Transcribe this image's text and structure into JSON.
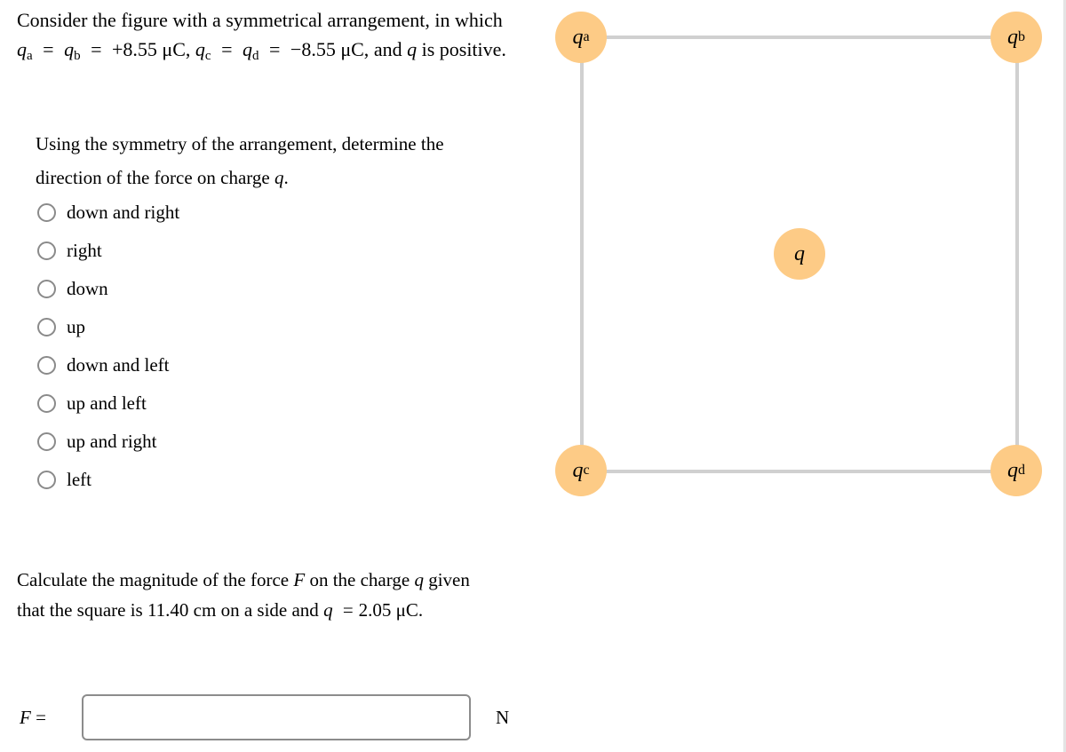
{
  "intro": {
    "line1": "Consider the figure with a symmetrical arrangement, in which",
    "qa_sym": "q",
    "qa_sub": "a",
    "qb_sym": "q",
    "qb_sub": "b",
    "positive_value": "+8.55 μC,",
    "qc_sym": "q",
    "qc_sub": "c",
    "qd_sym": "q",
    "qd_sub": "d",
    "negative_value": "−8.55 μC,",
    "tail_and": "and",
    "q_sym": "q",
    "tail": "is positive.",
    "equals": "="
  },
  "question": {
    "line1": "Using the symmetry of the arrangement, determine the",
    "line2_prefix": "direction of the force on charge",
    "q_sym": "q",
    "line2_suffix": "."
  },
  "options": [
    {
      "label": "down and right",
      "selected": false
    },
    {
      "label": "right",
      "selected": false
    },
    {
      "label": "down",
      "selected": false
    },
    {
      "label": "up",
      "selected": false
    },
    {
      "label": "down and left",
      "selected": false
    },
    {
      "label": "up and left",
      "selected": false
    },
    {
      "label": "up and right",
      "selected": false
    },
    {
      "label": "left",
      "selected": false
    }
  ],
  "calc": {
    "line1_prefix": "Calculate the magnitude of the force",
    "F_sym": "F",
    "line1_mid": "on the charge",
    "q_sym": "q",
    "line1_suffix": "given",
    "line2_prefix": "that the square is 11.40 cm on a side and",
    "q_sym2": "q",
    "equals": "=",
    "line2_value": "2.05 μC."
  },
  "answer": {
    "label_sym": "F",
    "label_eq": "=",
    "value": "",
    "placeholder": "",
    "unit": "N"
  },
  "diagram": {
    "colors": {
      "charge_fill": "#fdcb86",
      "edge": "#d0d0d0"
    },
    "charges": [
      {
        "id": "qa",
        "sym": "q",
        "sub": "a"
      },
      {
        "id": "qb",
        "sym": "q",
        "sub": "b"
      },
      {
        "id": "qc",
        "sym": "q",
        "sub": "c"
      },
      {
        "id": "qd",
        "sym": "q",
        "sub": "d"
      },
      {
        "id": "q",
        "sym": "q",
        "sub": ""
      }
    ]
  }
}
